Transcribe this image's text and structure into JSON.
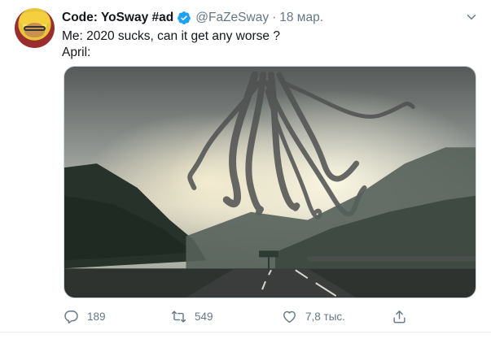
{
  "tweet": {
    "display_name": "Code: YoSway #ad",
    "handle": "@FaZeSway",
    "separator": "·",
    "timestamp": "18 мар.",
    "text_lines": [
      "Me: 2020 sucks, can it get any worse ?",
      "April:"
    ],
    "verified": true
  },
  "actions": {
    "reply_count": "189",
    "retweet_count": "549",
    "like_count": "7,8 тыс.",
    "share_count": ""
  },
  "icons": {
    "verified": "verified-badge-icon",
    "menu": "chevron-down-icon",
    "reply": "reply-icon",
    "retweet": "retweet-icon",
    "like": "heart-icon",
    "share": "share-icon"
  },
  "colors": {
    "primary_text": "#14171a",
    "secondary_text": "#657786",
    "verified_blue": "#1da1f2",
    "border": "#ccd6dd"
  }
}
